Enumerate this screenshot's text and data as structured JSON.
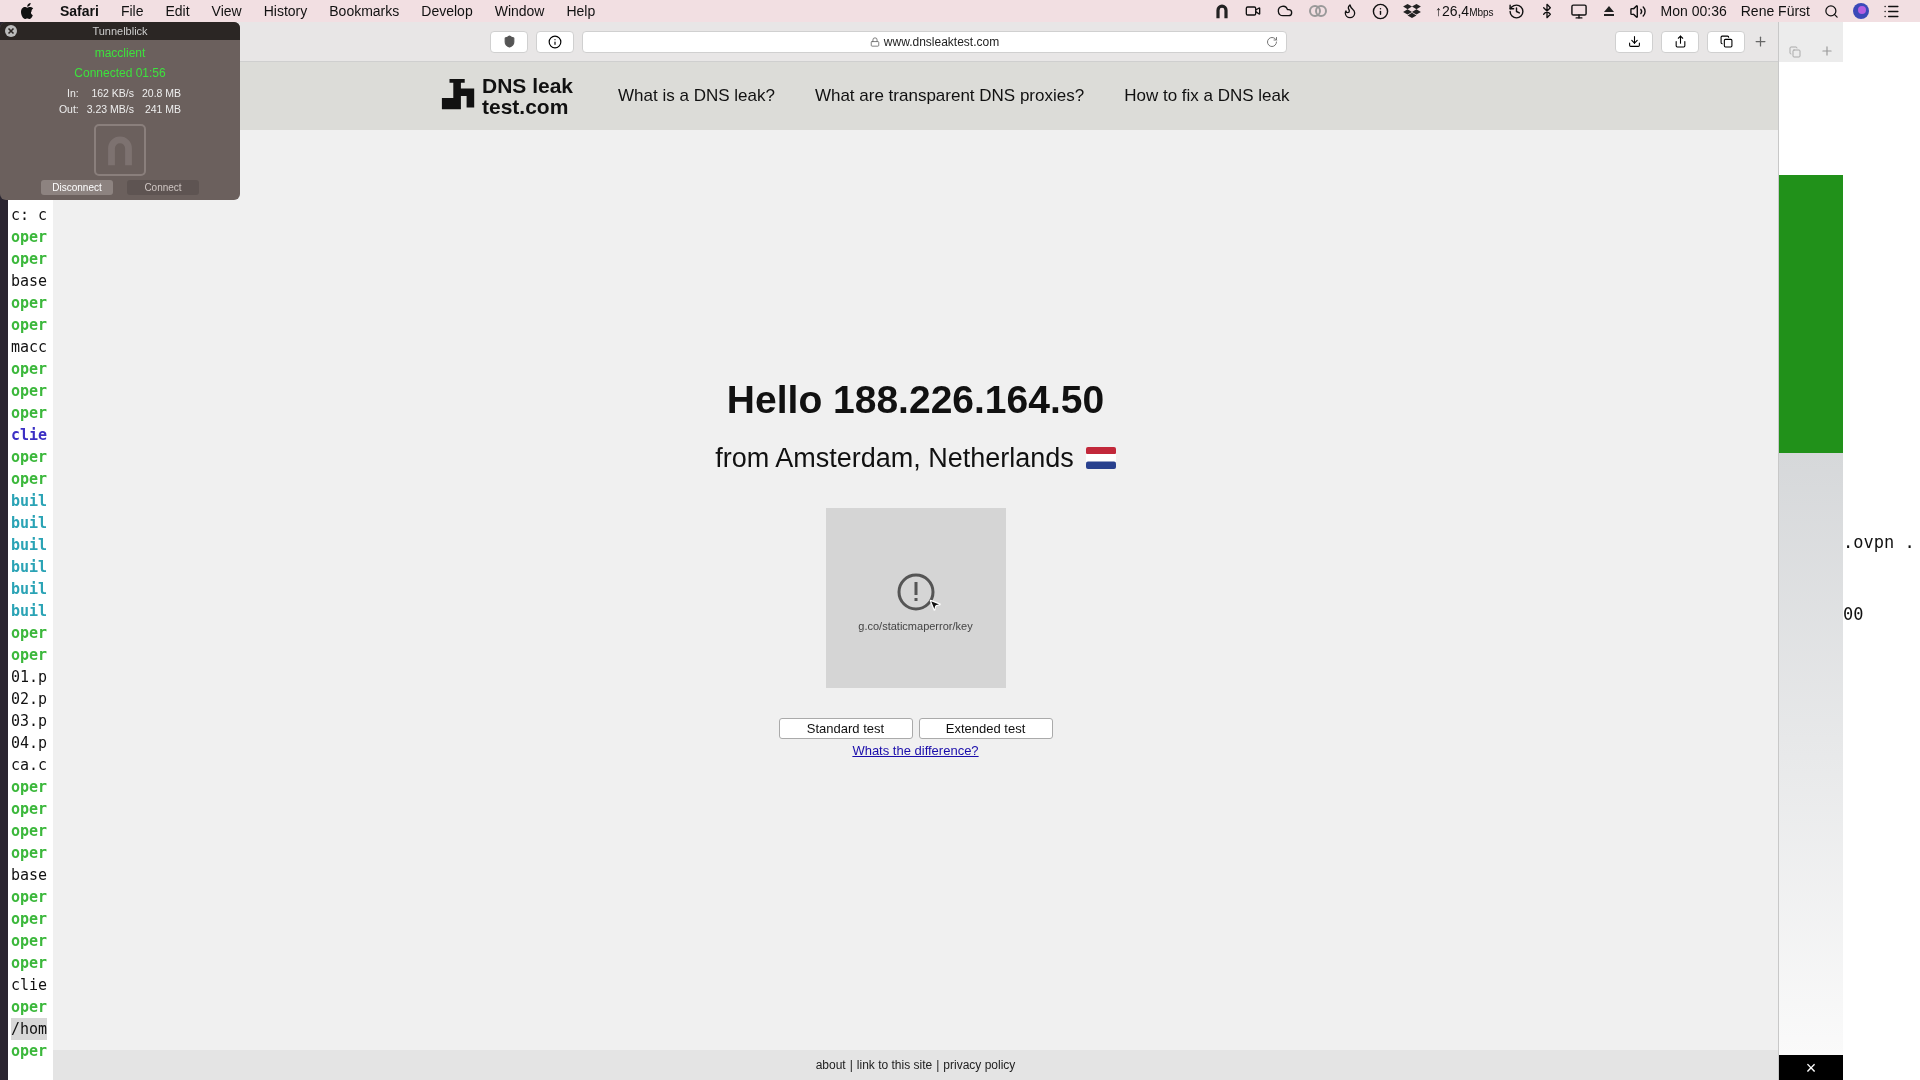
{
  "menu_bar": {
    "app_menu": "Safari",
    "menus": [
      "File",
      "Edit",
      "View",
      "History",
      "Bookmarks",
      "Develop",
      "Window",
      "Help"
    ],
    "speed": "↑26,4",
    "speed_unit": "Mbps",
    "clock": "Mon 00:36",
    "user": "Rene Fürst"
  },
  "tunnelblick": {
    "title": "Tunnelblick",
    "config": "macclient",
    "status": "Connected 01:56",
    "stats": [
      {
        "label": "In:",
        "rate": "162 KB/s",
        "total": "20.8 MB"
      },
      {
        "label": "Out:",
        "rate": "3.23 MB/s",
        "total": "241 MB"
      }
    ],
    "buttons": [
      {
        "label": "Disconnect",
        "disabled": false
      },
      {
        "label": "Connect",
        "disabled": true
      }
    ]
  },
  "terminal_left": {
    "lines": [
      {
        "text": "c: c",
        "kind": "plain"
      },
      {
        "text": "oper",
        "kind": "green"
      },
      {
        "text": "oper",
        "kind": "green"
      },
      {
        "text": "base",
        "kind": "plain"
      },
      {
        "text": "oper",
        "kind": "green"
      },
      {
        "text": "oper",
        "kind": "green"
      },
      {
        "text": "macc",
        "kind": "plain"
      },
      {
        "text": "oper",
        "kind": "green"
      },
      {
        "text": "oper",
        "kind": "green"
      },
      {
        "text": "oper",
        "kind": "green"
      },
      {
        "text": "clie",
        "kind": "blue"
      },
      {
        "text": "oper",
        "kind": "green"
      },
      {
        "text": "oper",
        "kind": "green"
      },
      {
        "text": "buil",
        "kind": "teal"
      },
      {
        "text": "buil",
        "kind": "teal"
      },
      {
        "text": "buil",
        "kind": "teal"
      },
      {
        "text": "buil",
        "kind": "teal"
      },
      {
        "text": "buil",
        "kind": "teal"
      },
      {
        "text": "buil",
        "kind": "teal"
      },
      {
        "text": "oper",
        "kind": "green"
      },
      {
        "text": "oper",
        "kind": "green"
      },
      {
        "text": "01.p",
        "kind": "plain"
      },
      {
        "text": "02.p",
        "kind": "plain"
      },
      {
        "text": "03.p",
        "kind": "plain"
      },
      {
        "text": "04.p",
        "kind": "plain"
      },
      {
        "text": "ca.c",
        "kind": "plain"
      },
      {
        "text": "oper",
        "kind": "green"
      },
      {
        "text": "oper",
        "kind": "green"
      },
      {
        "text": "oper",
        "kind": "green"
      },
      {
        "text": "oper",
        "kind": "green"
      },
      {
        "text": "base",
        "kind": "plain"
      },
      {
        "text": "oper",
        "kind": "green"
      },
      {
        "text": "oper",
        "kind": "green"
      },
      {
        "text": "oper",
        "kind": "green"
      },
      {
        "text": "oper",
        "kind": "green"
      },
      {
        "text": "clie",
        "kind": "plain"
      },
      {
        "text": "oper",
        "kind": "green"
      },
      {
        "text": "/hom",
        "kind": "selected"
      },
      {
        "text": "oper",
        "kind": "green"
      }
    ]
  },
  "browser": {
    "url": "www.dnsleaktest.com",
    "logo": [
      "DNS leak",
      "test.com"
    ],
    "nav_links": [
      "What is a DNS leak?",
      "What are transparent DNS proxies?",
      "How to fix a DNS leak"
    ],
    "greeting": "Hello 188.226.164.50",
    "location": "from Amsterdam, Netherlands",
    "map_error": "g.co/staticmaperror/key",
    "buttons": [
      "Standard test",
      "Extended test"
    ],
    "link": "Whats the difference?",
    "footer_links": [
      "about",
      "link to this site",
      "privacy policy"
    ],
    "footer_separator": "|"
  },
  "side_window": {
    "close_glyph": "×"
  },
  "terminal_right": {
    "lines": [
      ".ovpn .",
      "00"
    ]
  }
}
